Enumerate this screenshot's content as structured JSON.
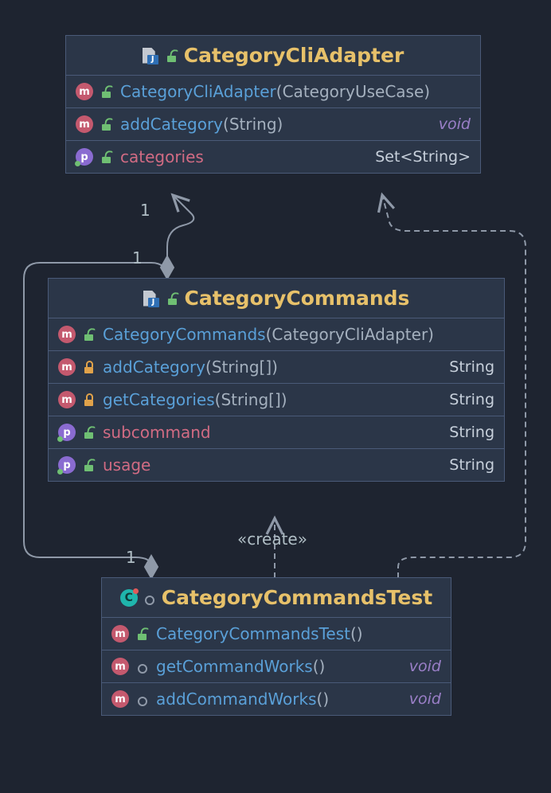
{
  "labels": {
    "create": "«create»",
    "one_a": "1",
    "one_b": "1",
    "one_c": "1"
  },
  "classes": {
    "adapter": {
      "name": "CategoryCliAdapter",
      "rows": [
        {
          "kind": "m",
          "vis": "open",
          "sig_name": "CategoryCliAdapter",
          "sig_args": "CategoryUseCase",
          "ret": "",
          "ret_kind": ""
        },
        {
          "kind": "m",
          "vis": "open",
          "sig_name": "addCategory",
          "sig_args": "String",
          "ret": "void",
          "ret_kind": "void"
        },
        {
          "kind": "p",
          "vis": "open",
          "sig_name": "categories",
          "sig_args": null,
          "ret": "Set<String>",
          "ret_kind": "type"
        }
      ]
    },
    "commands": {
      "name": "CategoryCommands",
      "rows": [
        {
          "kind": "m",
          "vis": "open",
          "sig_name": "CategoryCommands",
          "sig_args": "CategoryCliAdapter",
          "ret": "",
          "ret_kind": ""
        },
        {
          "kind": "m",
          "vis": "closed",
          "sig_name": "addCategory",
          "sig_args": "String[]",
          "ret": "String",
          "ret_kind": "type"
        },
        {
          "kind": "m",
          "vis": "closed",
          "sig_name": "getCategories",
          "sig_args": "String[]",
          "ret": "String",
          "ret_kind": "type"
        },
        {
          "kind": "p",
          "vis": "open",
          "sig_name": "subcommand",
          "sig_args": null,
          "ret": "String",
          "ret_kind": "type"
        },
        {
          "kind": "p",
          "vis": "open",
          "sig_name": "usage",
          "sig_args": null,
          "ret": "String",
          "ret_kind": "type"
        }
      ]
    },
    "test": {
      "name": "CategoryCommandsTest",
      "rows": [
        {
          "kind": "m",
          "vis": "open",
          "sig_name": "CategoryCommandsTest",
          "sig_args": "",
          "ret": "",
          "ret_kind": ""
        },
        {
          "kind": "m",
          "vis": "ring",
          "sig_name": "getCommandWorks",
          "sig_args": "",
          "ret": "void",
          "ret_kind": "void"
        },
        {
          "kind": "m",
          "vis": "ring",
          "sig_name": "addCommandWorks",
          "sig_args": "",
          "ret": "void",
          "ret_kind": "void"
        }
      ]
    }
  }
}
